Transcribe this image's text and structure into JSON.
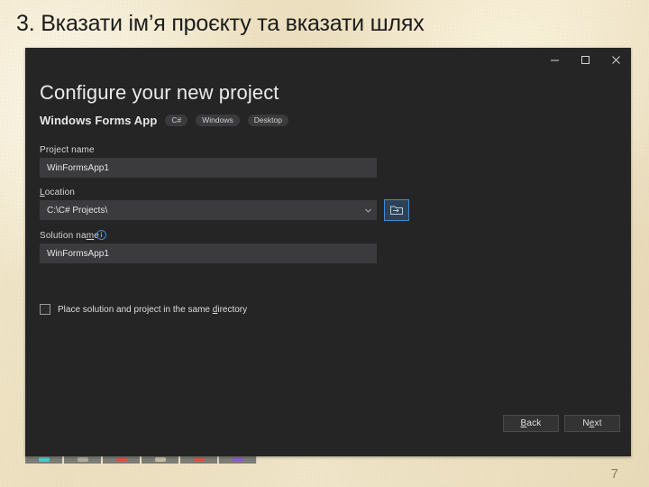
{
  "slide": {
    "title": "3. Вказати ім’я проєкту та вказати шлях",
    "page_number": "7",
    "background_color": "#f0e3c6"
  },
  "dialog": {
    "background_color": "#252526",
    "accent_color": "#3e8ad6",
    "titlebar": {
      "minimize_label": "Minimize",
      "maximize_label": "Maximize",
      "close_label": "Close"
    },
    "heading": "Configure your new project",
    "subheading": "Windows Forms App",
    "tags": [
      "C#",
      "Windows",
      "Desktop"
    ],
    "fields": {
      "project_name": {
        "label": "Project name",
        "value": "WinFormsApp1",
        "placeholder": "Project name"
      },
      "location": {
        "label_prefix": "",
        "label_mnemonic": "L",
        "label_suffix": "ocation",
        "value": "C:\\C# Projects\\",
        "placeholder": "Location",
        "browse_label": "Browse"
      },
      "solution_name": {
        "label_prefix": "Solution na",
        "label_mnemonic": "m",
        "label_suffix": "e",
        "value": "WinFormsApp1",
        "placeholder": "Solution name",
        "info_glyph": "i",
        "info_tooltip": "Solution name info"
      }
    },
    "checkbox": {
      "label_prefix": "Place solution and project in the same ",
      "label_mnemonic": "d",
      "label_suffix": "irectory",
      "checked": false
    },
    "buttons": {
      "back": {
        "prefix": "",
        "mnemonic": "B",
        "suffix": "ack"
      },
      "next": {
        "prefix": "N",
        "mnemonic": "e",
        "suffix": "xt"
      }
    }
  },
  "taskbar": {
    "thumbnails": [
      {
        "dot_color": "#3fd0c9"
      },
      {
        "dot_color": "#b3ad9a"
      },
      {
        "dot_color": "#d4544a"
      },
      {
        "dot_color": "#c7bda4"
      },
      {
        "dot_color": "#d2564d"
      },
      {
        "dot_color": "#8b5ec4"
      }
    ]
  }
}
